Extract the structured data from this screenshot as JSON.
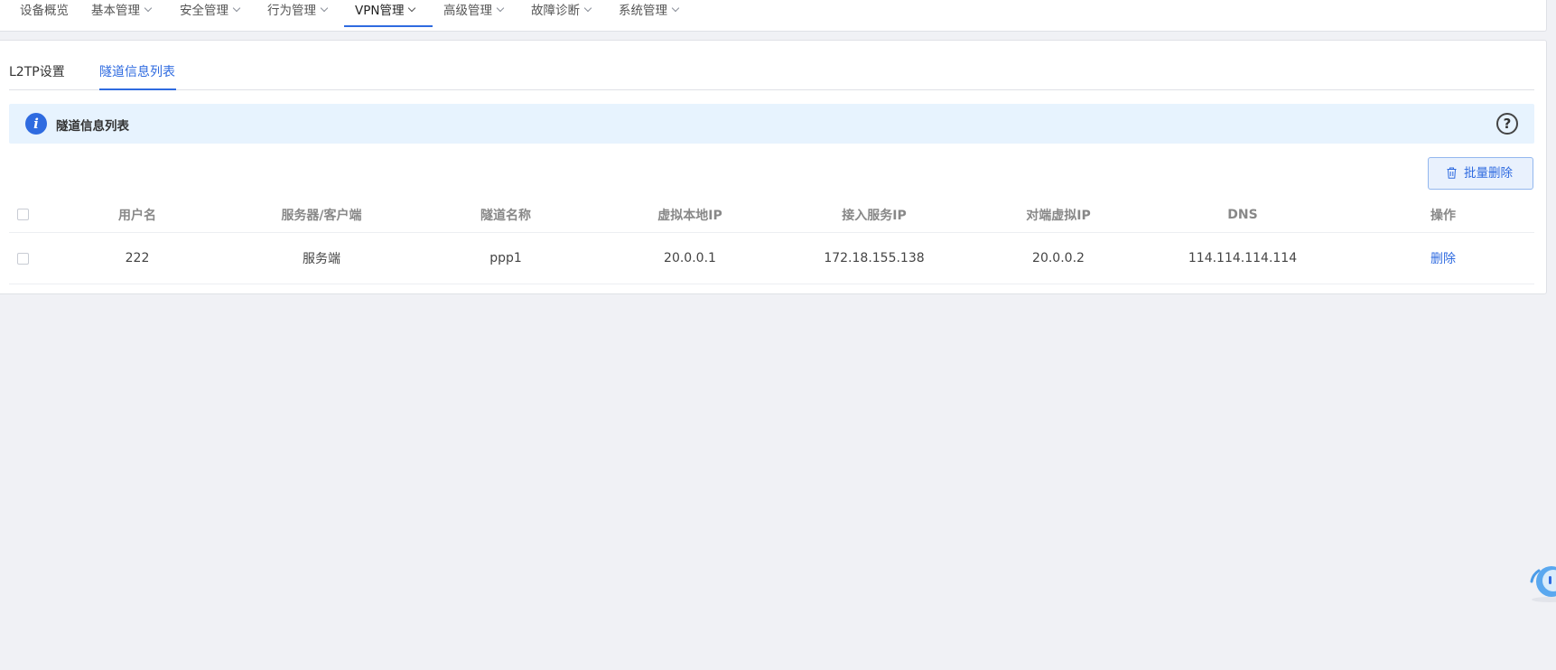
{
  "nav": {
    "items": [
      {
        "label": "设备概览",
        "dropdown": false
      },
      {
        "label": "基本管理",
        "dropdown": true
      },
      {
        "label": "安全管理",
        "dropdown": true
      },
      {
        "label": "行为管理",
        "dropdown": true
      },
      {
        "label": "VPN管理",
        "dropdown": true,
        "active": true
      },
      {
        "label": "高级管理",
        "dropdown": true
      },
      {
        "label": "故障诊断",
        "dropdown": true
      },
      {
        "label": "系统管理",
        "dropdown": true
      }
    ]
  },
  "tabs": {
    "l2tp": "L2TP设置",
    "tunnel_list": "隧道信息列表",
    "active": "tunnel_list"
  },
  "info": {
    "icon_glyph": "i",
    "title": "隧道信息列表",
    "help_glyph": "?"
  },
  "toolbar": {
    "batch_delete_label": "批量删除"
  },
  "table": {
    "headers": [
      "用户名",
      "服务器/客户端",
      "隧道名称",
      "虚拟本地IP",
      "接入服务IP",
      "对端虚拟IP",
      "DNS",
      "操作"
    ],
    "rows": [
      {
        "checked": false,
        "username": "222",
        "role": "服务端",
        "tunnel_name": "ppp1",
        "local_virtual_ip": "20.0.0.1",
        "access_service_ip": "172.18.155.138",
        "peer_virtual_ip": "20.0.0.2",
        "dns": "114.114.114.114",
        "action": "删除"
      }
    ]
  },
  "colors": {
    "accent": "#2f6be0",
    "info_bg": "#e7f3fe",
    "page_bg": "#f0f1f5"
  }
}
